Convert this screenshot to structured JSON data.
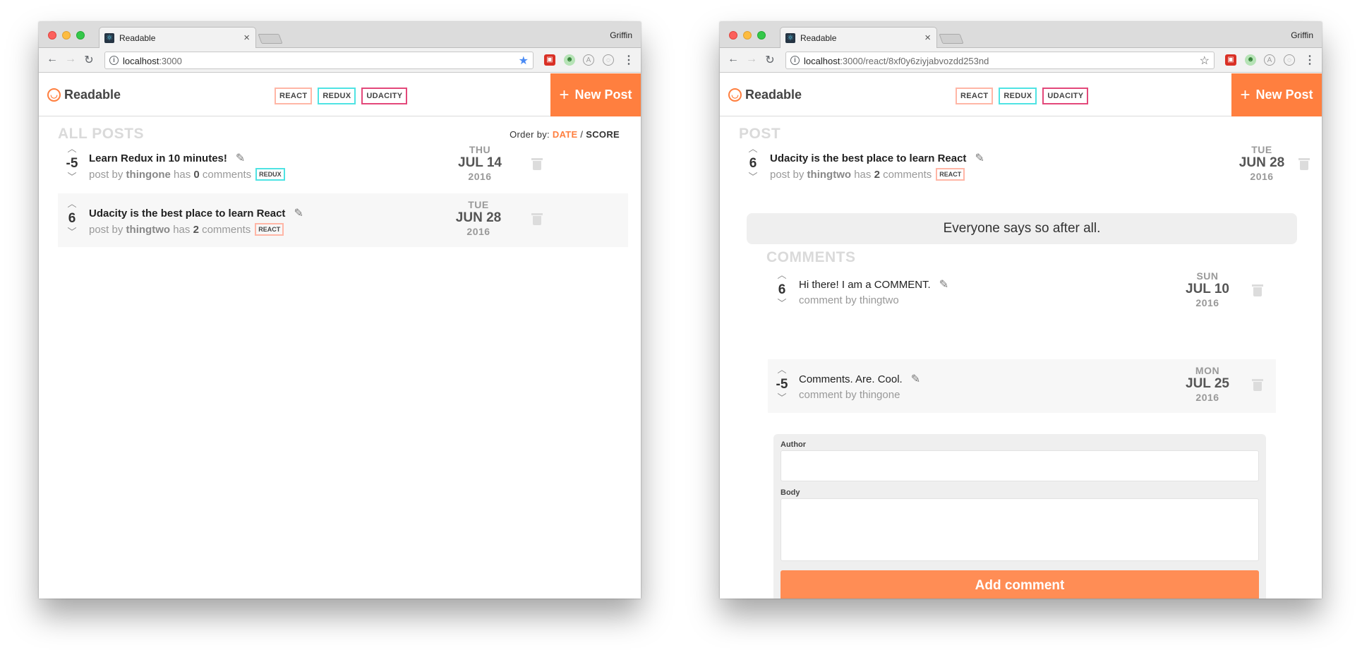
{
  "browser": {
    "profile": "Griffin",
    "tab_title": "Readable",
    "left_url_host": "localhost",
    "left_url_rest": ":3000",
    "right_url_host": "localhost",
    "right_url_rest": ":3000/react/8xf0y6ziyjabvozdd253nd"
  },
  "app": {
    "brand": "Readable",
    "categories": [
      "REACT",
      "REDUX",
      "UDACITY"
    ],
    "new_post_label": "New Post"
  },
  "list_view": {
    "section_title": "ALL POSTS",
    "order_by_label": "Order by:",
    "order_date": "DATE",
    "order_sep": "/",
    "order_score": "SCORE",
    "posts": [
      {
        "score": "-5",
        "title": "Learn Redux in 10 minutes!",
        "by": "post by",
        "author": "thingone",
        "has": "has",
        "comment_count": "0",
        "comments_word": "comments",
        "tag": "REDUX",
        "dow": "THU",
        "md": "JUL 14",
        "year": "2016"
      },
      {
        "score": "6",
        "title": "Udacity is the best place to learn React",
        "by": "post by",
        "author": "thingtwo",
        "has": "has",
        "comment_count": "2",
        "comments_word": "comments",
        "tag": "REACT",
        "dow": "TUE",
        "md": "JUN 28",
        "year": "2016"
      }
    ]
  },
  "detail_view": {
    "section_title": "POST",
    "post": {
      "score": "6",
      "title": "Udacity is the best place to learn React",
      "by": "post by",
      "author": "thingtwo",
      "has": "has",
      "comment_count": "2",
      "comments_word": "comments",
      "tag": "REACT",
      "dow": "TUE",
      "md": "JUN 28",
      "year": "2016"
    },
    "body": "Everyone says so after all.",
    "comments_title": "COMMENTS",
    "comments": [
      {
        "score": "6",
        "text": "Hi there! I am a COMMENT.",
        "meta": "comment by thingtwo",
        "dow": "SUN",
        "md": "JUL 10",
        "year": "2016"
      },
      {
        "score": "-5",
        "text": "Comments. Are. Cool.",
        "meta": "comment by thingone",
        "dow": "MON",
        "md": "JUL 25",
        "year": "2016"
      }
    ],
    "form": {
      "author_label": "Author",
      "body_label": "Body",
      "submit_label": "Add comment"
    }
  },
  "colors": {
    "accent": "#ff7f3f",
    "react": "#ffb6a6",
    "redux": "#4fe3e3",
    "udacity": "#e3487a"
  }
}
